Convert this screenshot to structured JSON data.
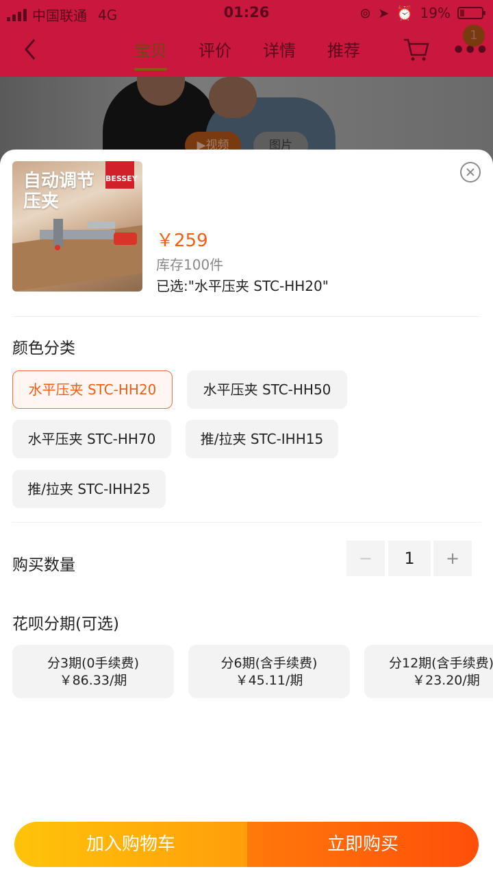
{
  "status_bar": {
    "carrier": "中国联通",
    "network": "4G",
    "time": "01:26",
    "battery": "19%",
    "battery_level": 0.19
  },
  "nav": {
    "tabs": [
      {
        "label": "宝贝",
        "active": true
      },
      {
        "label": "评价",
        "active": false
      },
      {
        "label": "详情",
        "active": false
      },
      {
        "label": "推荐",
        "active": false
      }
    ],
    "badge_count": "1"
  },
  "media": {
    "video_label": "▶视频",
    "image_label": "图片"
  },
  "product": {
    "thumb_title_line1": "自动调节",
    "thumb_title_line2": "压夹",
    "brand_logo": "BESSEY",
    "price": "￥259",
    "stock": "库存100件",
    "selected": "已选:\"水平压夹 STC-HH20\""
  },
  "color": {
    "title": "颜色分类",
    "options": [
      {
        "label": "水平压夹 STC-HH20",
        "selected": true
      },
      {
        "label": "水平压夹 STC-HH50",
        "selected": false
      },
      {
        "label": "水平压夹 STC-HH70",
        "selected": false
      },
      {
        "label": "推/拉夹 STC-IHH15",
        "selected": false
      },
      {
        "label": "推/拉夹 STC-IHH25",
        "selected": false
      }
    ]
  },
  "quantity": {
    "title": "购买数量",
    "minus": "−",
    "value": "1",
    "plus": "+"
  },
  "installment": {
    "title": "花呗分期(可选)",
    "plans": [
      {
        "period": "分3期(0手续费)",
        "amount": "￥86.33/期"
      },
      {
        "period": "分6期(含手续费)",
        "amount": "￥45.11/期"
      },
      {
        "period": "分12期(含手续费)",
        "amount": "￥23.20/期"
      }
    ]
  },
  "actions": {
    "add_to_cart": "加入购物车",
    "buy_now": "立即购买"
  },
  "colors": {
    "accent": "#f35d10",
    "header_dim": "#c9173d",
    "cart_button": "#ffb30a",
    "buy_button": "#ff5a0a"
  }
}
